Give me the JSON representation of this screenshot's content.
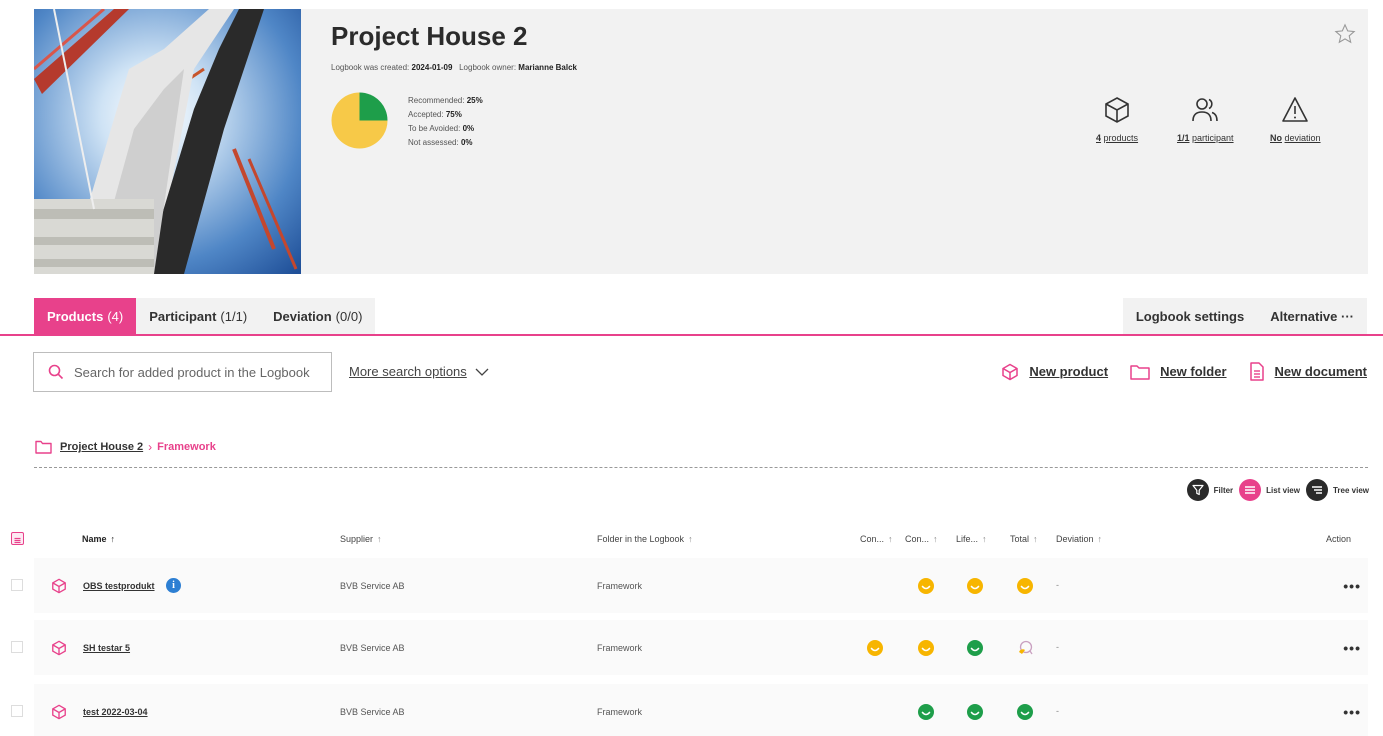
{
  "project": {
    "title": "Project House 2",
    "created_label": "Logbook was created:",
    "created_date": "2024-01-09",
    "owner_label": "Logbook owner:",
    "owner_name": "Marianne Balck"
  },
  "assessment": [
    {
      "label": "Recommended:",
      "value": "25%",
      "color": "#1e9e4a",
      "fraction": 0.25
    },
    {
      "label": "Accepted:",
      "value": "75%",
      "color": "#f7c948",
      "fraction": 0.75
    },
    {
      "label": "To be Avoided:",
      "value": "0%",
      "color": "#e03a3a",
      "fraction": 0
    },
    {
      "label": "Not assessed:",
      "value": "0%",
      "color": "#cccccc",
      "fraction": 0
    }
  ],
  "stats": {
    "products_bold": "4",
    "products_text": "products",
    "participants_bold": "1/1",
    "participants_text": "participant",
    "deviation_bold": "No",
    "deviation_text": "deviation"
  },
  "tabs": [
    {
      "label": "Products",
      "count": "(4)"
    },
    {
      "label": "Participant",
      "count": "(1/1)"
    },
    {
      "label": "Deviation",
      "count": "(0/0)"
    }
  ],
  "tabs_right": {
    "settings": "Logbook settings",
    "alternative": "Alternative ···"
  },
  "search": {
    "placeholder": "Search for added product in the Logbook",
    "more": "More search options"
  },
  "actions": {
    "new_product": "New product",
    "new_folder": "New folder",
    "new_document": "New document"
  },
  "breadcrumb": {
    "root": "Project House 2",
    "current": "Framework"
  },
  "views": {
    "filter": "Filter",
    "list": "List view",
    "tree": "Tree view"
  },
  "table": {
    "headers": {
      "name": "Name",
      "supplier": "Supplier",
      "folder": "Folder in the Logbook",
      "con1": "Con...",
      "con2": "Con...",
      "life": "Life...",
      "total": "Total",
      "deviation": "Deviation",
      "action": "Action"
    },
    "rows": [
      {
        "name": "OBS testprodukt",
        "supplier": "BVB Service AB",
        "folder": "Framework",
        "info": true,
        "ratings": [
          "",
          "accepted",
          "accepted",
          "accepted"
        ],
        "deviation": "-",
        "action": "•••"
      },
      {
        "name": "SH testar 5",
        "supplier": "BVB Service AB",
        "folder": "Framework",
        "info": false,
        "ratings": [
          "accepted",
          "accepted",
          "recommended",
          "partial"
        ],
        "deviation": "-",
        "action": "•••"
      },
      {
        "name": "test 2022-03-04",
        "supplier": "BVB Service AB",
        "folder": "Framework",
        "info": false,
        "ratings": [
          "",
          "recommended",
          "recommended",
          "recommended"
        ],
        "deviation": "-",
        "action": "•••"
      }
    ]
  },
  "colors": {
    "accent": "#e8418b",
    "recommended": "#1e9e4a",
    "accepted": "#f7b500",
    "info": "#2d7fd3"
  },
  "icons": [
    "star-icon",
    "cube-icon",
    "users-icon",
    "warning-icon",
    "search-icon",
    "chevron-down-icon",
    "folder-icon",
    "document-icon",
    "filter-icon",
    "list-icon",
    "tree-icon",
    "info-icon",
    "smiley-icon"
  ]
}
